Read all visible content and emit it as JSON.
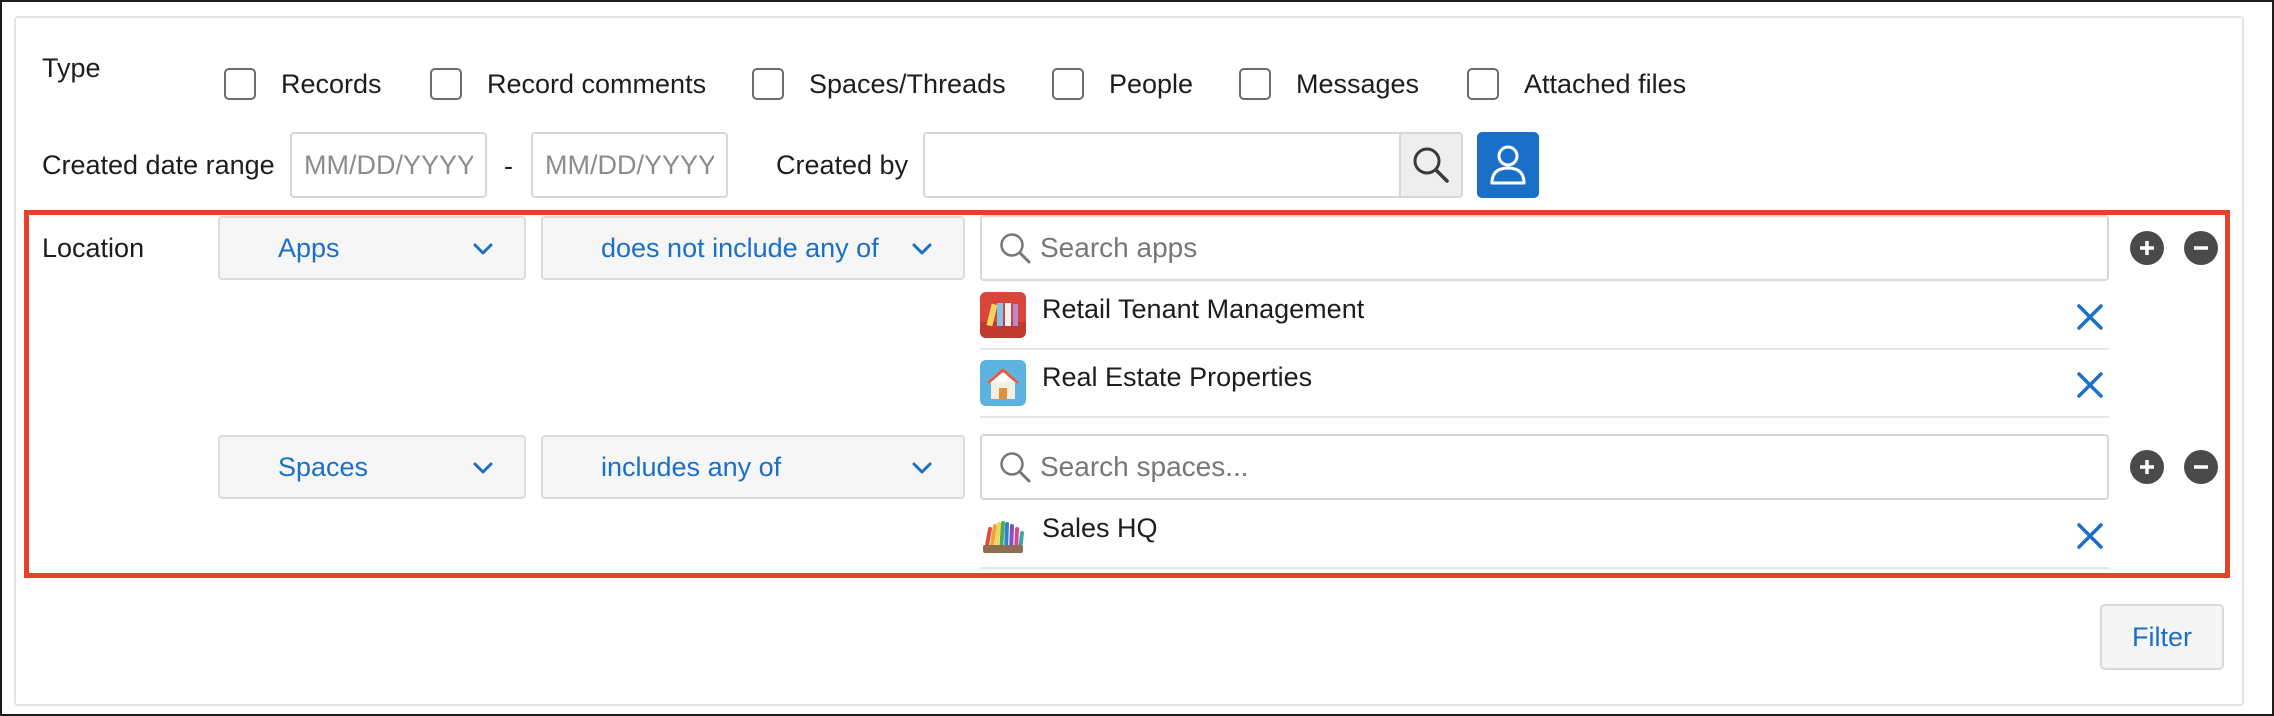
{
  "type_section": {
    "label": "Type",
    "options": [
      {
        "label": "Records",
        "checked": false
      },
      {
        "label": "Record comments",
        "checked": false
      },
      {
        "label": "Spaces/Threads",
        "checked": false
      },
      {
        "label": "People",
        "checked": false
      },
      {
        "label": "Messages",
        "checked": false
      },
      {
        "label": "Attached files",
        "checked": false
      }
    ]
  },
  "date_range": {
    "label": "Created date range",
    "start_placeholder": "MM/DD/YYYY",
    "separator": "-",
    "end_placeholder": "MM/DD/YYYY"
  },
  "created_by": {
    "label": "Created by",
    "value": "",
    "search_icon": "magnifier-icon",
    "user_icon": "person-icon"
  },
  "location": {
    "label": "Location",
    "rows": [
      {
        "scope": "Apps",
        "operator": "does not include any of",
        "search_placeholder": "Search apps",
        "items": [
          {
            "name": "Retail Tenant Management",
            "icon": "binders-app-icon"
          },
          {
            "name": "Real Estate Properties",
            "icon": "house-app-icon"
          }
        ]
      },
      {
        "scope": "Spaces",
        "operator": "includes any of",
        "search_placeholder": "Search spaces...",
        "items": [
          {
            "name": "Sales HQ",
            "icon": "pencils-space-icon"
          }
        ]
      }
    ]
  },
  "filter_button": "Filter",
  "colors": {
    "accent": "#1a6fc9",
    "highlight_border": "#e4422b",
    "round_button": "#4a4a4a"
  }
}
